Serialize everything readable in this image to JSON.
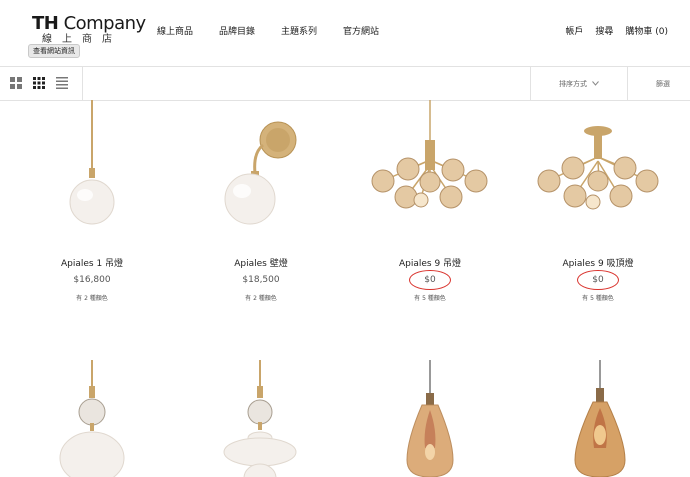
{
  "logo": {
    "main_bold": "TH",
    "main_rest": " Company",
    "sub": "線上商店",
    "tooltip": "查看網站資訊"
  },
  "nav": [
    "線上商品",
    "品牌目錄",
    "主題系列",
    "官方網站"
  ],
  "util": [
    "帳戶",
    "搜尋",
    "購物車 (0)"
  ],
  "toolbar": {
    "sort_label": "排序方式",
    "filter_label": "篩選"
  },
  "products": [
    {
      "name": "Apiales 1 吊燈",
      "price": "$16,800",
      "colors": "有 2 種顏色"
    },
    {
      "name": "Apiales 壁燈",
      "price": "$18,500",
      "colors": "有 2 種顏色"
    },
    {
      "name": "Apiales 9 吊燈",
      "price": "$0",
      "colors": "有 5 種顏色"
    },
    {
      "name": "Apiales 9 吸頂燈",
      "price": "$0",
      "colors": "有 5 種顏色"
    }
  ],
  "colors": {
    "brass": "#c9a56a",
    "highlight_circle": "#d9312b",
    "amber_glass": "#d9a46c"
  }
}
